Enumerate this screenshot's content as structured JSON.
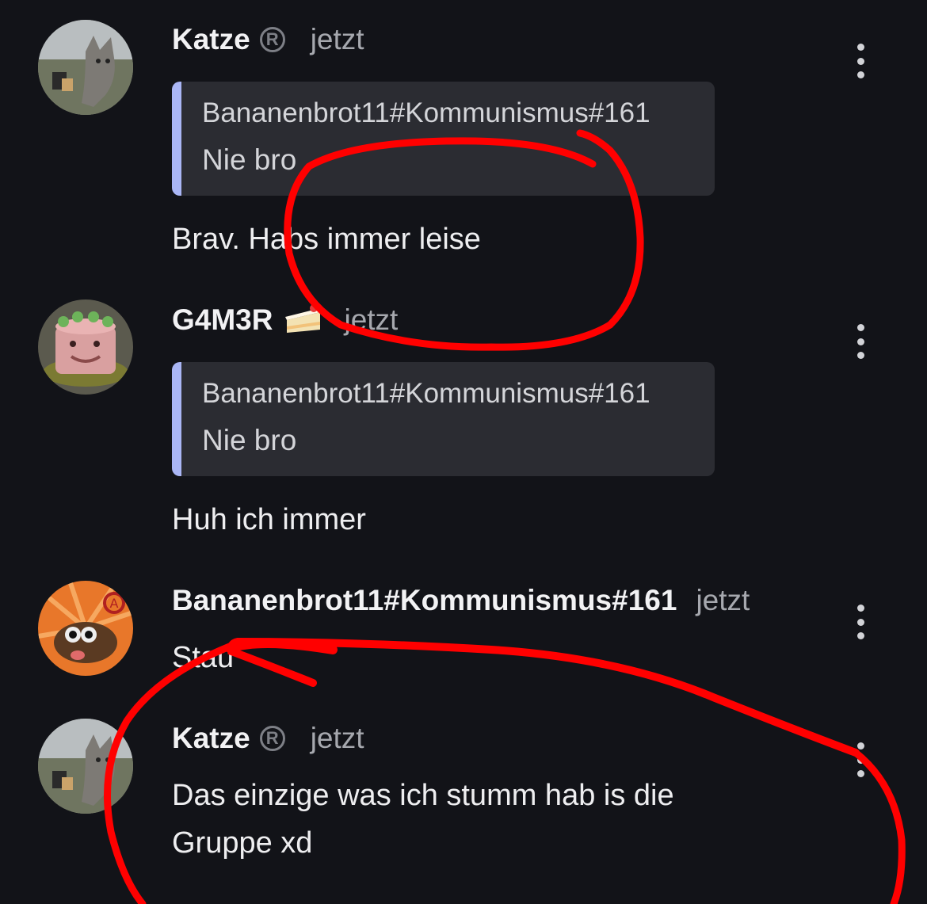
{
  "messages": [
    {
      "author": "Katze",
      "badge": "R",
      "time": "jetzt",
      "quote": {
        "author": "Bananenbrot11#Kommunismus#161",
        "text": "Nie bro"
      },
      "text": "Brav. Habs immer leise",
      "avatar": "cat-icon"
    },
    {
      "author": "G4M3R",
      "time": "jetzt",
      "quote": {
        "author": "Bananenbrot11#Kommunismus#161",
        "text": "Nie bro"
      },
      "text": "Huh ich immer",
      "avatar": "cake-face-icon",
      "emoji": "cake-emoji-icon"
    },
    {
      "author": "Bananenbrot11#Kommunismus#161",
      "time": "jetzt",
      "text": "Stau",
      "avatar": "bug-anarchy-icon"
    },
    {
      "author": "Katze",
      "badge": "R",
      "time": "jetzt",
      "text_line1": "Das einzige was ich stumm hab is die",
      "text_line2": "Gruppe xd",
      "avatar": "cat-icon"
    }
  ],
  "colors": {
    "background": "#121318",
    "quote_bg": "#2b2c32",
    "quote_bar": "#aab6f5",
    "annotation": "#ff0000"
  }
}
